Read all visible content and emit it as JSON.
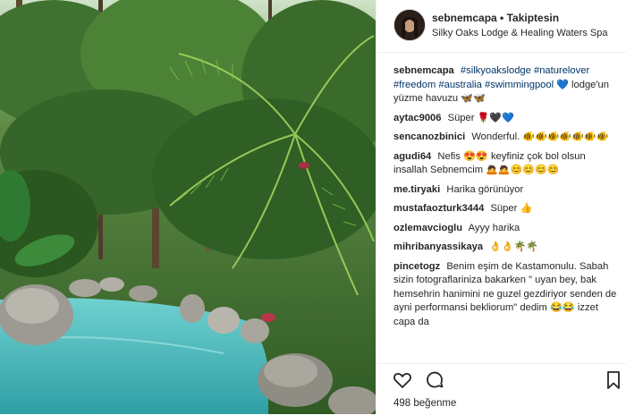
{
  "header": {
    "username": "sebnemcapa",
    "separator": "•",
    "follow_label": "Takiptesin",
    "location": "Silky Oaks Lodge & Healing Waters Spa"
  },
  "caption": {
    "username": "sebnemcapa",
    "hashtags": [
      "#silkyoakslodge",
      "#naturelover",
      "#freedom",
      "#australia",
      "#swimmingpool"
    ],
    "emoji_after_tags": "💙",
    "text": "lodge'un yüzme havuzu",
    "emoji_after_text": "🦋🦋"
  },
  "comments": [
    {
      "user": "aytac9006",
      "text": "Süper",
      "emoji": "🌹🖤💙"
    },
    {
      "user": "sencanozbinici",
      "text": "Wonderful.",
      "emoji": "🐠🐠🐠🐠🐠🐠🐠"
    },
    {
      "user": "agudi64",
      "text": "Nefis 😍😍 keyfiniz çok bol olsun insallah Sebnemcim",
      "emoji": "🙇🙇😊😊😊😊"
    },
    {
      "user": "me.tiryaki",
      "text": "Harika görünüyor",
      "emoji": ""
    },
    {
      "user": "mustafaozturk3444",
      "text": "Süper",
      "emoji": "👍"
    },
    {
      "user": "ozlemavcioglu",
      "text": "Ayyy harika",
      "emoji": ""
    },
    {
      "user": "mihribanyassikaya",
      "text": "",
      "emoji": "👌👌🌴🌴"
    },
    {
      "user": "pincetogz",
      "text": "Benim eşim de Kastamonulu. Sabah sizin fotograflariniza bakarken \" uyan bey, bak hemsehrin hanimini ne guzel gezdiriyor senden de ayni performansi bekliorum\" dedim 😂😂 izzet capa da",
      "emoji": ""
    }
  ],
  "actions": {
    "like_icon": "heart-icon",
    "comment_icon": "comment-icon",
    "save_icon": "bookmark-icon",
    "likes_text": "498 beğenme"
  }
}
